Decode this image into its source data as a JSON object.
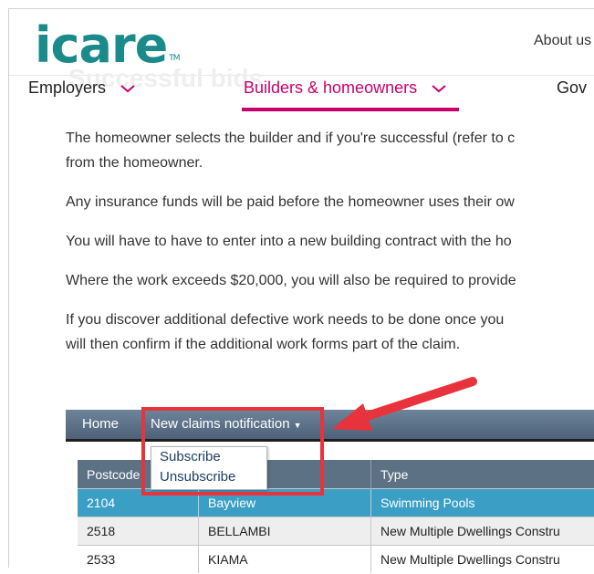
{
  "site": {
    "logo_text": "icare",
    "trademark": "TM",
    "about_link": "About us",
    "ghost_heading": "Successful bids",
    "brand_color": "#1a8a8a",
    "accent_color": "#c8006e"
  },
  "nav": {
    "employers": "Employers",
    "builders": "Builders & homeowners",
    "gov": "Gov",
    "active": "Builders & homeowners"
  },
  "content": {
    "p1_line1": "The homeowner selects the builder and if you're successful (refer to c",
    "p1_line2": "from the homeowner.",
    "p2": "Any insurance funds will be paid before the homeowner uses their ow",
    "p3": "You will have to have to enter into a new building contract with the ho",
    "p4": "Where the work exceeds $20,000, you will also be required to provide",
    "p5_line1": "If you discover additional defective work needs to be done once you",
    "p5_line2": "will then confirm if the additional work forms part of the claim."
  },
  "app": {
    "nav_home": "Home",
    "nav_claims": "New claims notification",
    "dropdown": {
      "subscribe": "Subscribe",
      "unsubscribe": "Unsubscribe"
    },
    "table": {
      "headers": [
        "Postcode",
        "",
        "Type"
      ],
      "rows": [
        {
          "postcode": "2104",
          "suburb": "Bayview",
          "type": "Swimming Pools"
        },
        {
          "postcode": "2518",
          "suburb": "BELLAMBI",
          "type": "New Multiple Dwellings Constru"
        },
        {
          "postcode": "2533",
          "suburb": "KIAMA",
          "type": "New Multiple Dwellings Constru"
        }
      ]
    },
    "highlight_color": "#e8323c"
  }
}
